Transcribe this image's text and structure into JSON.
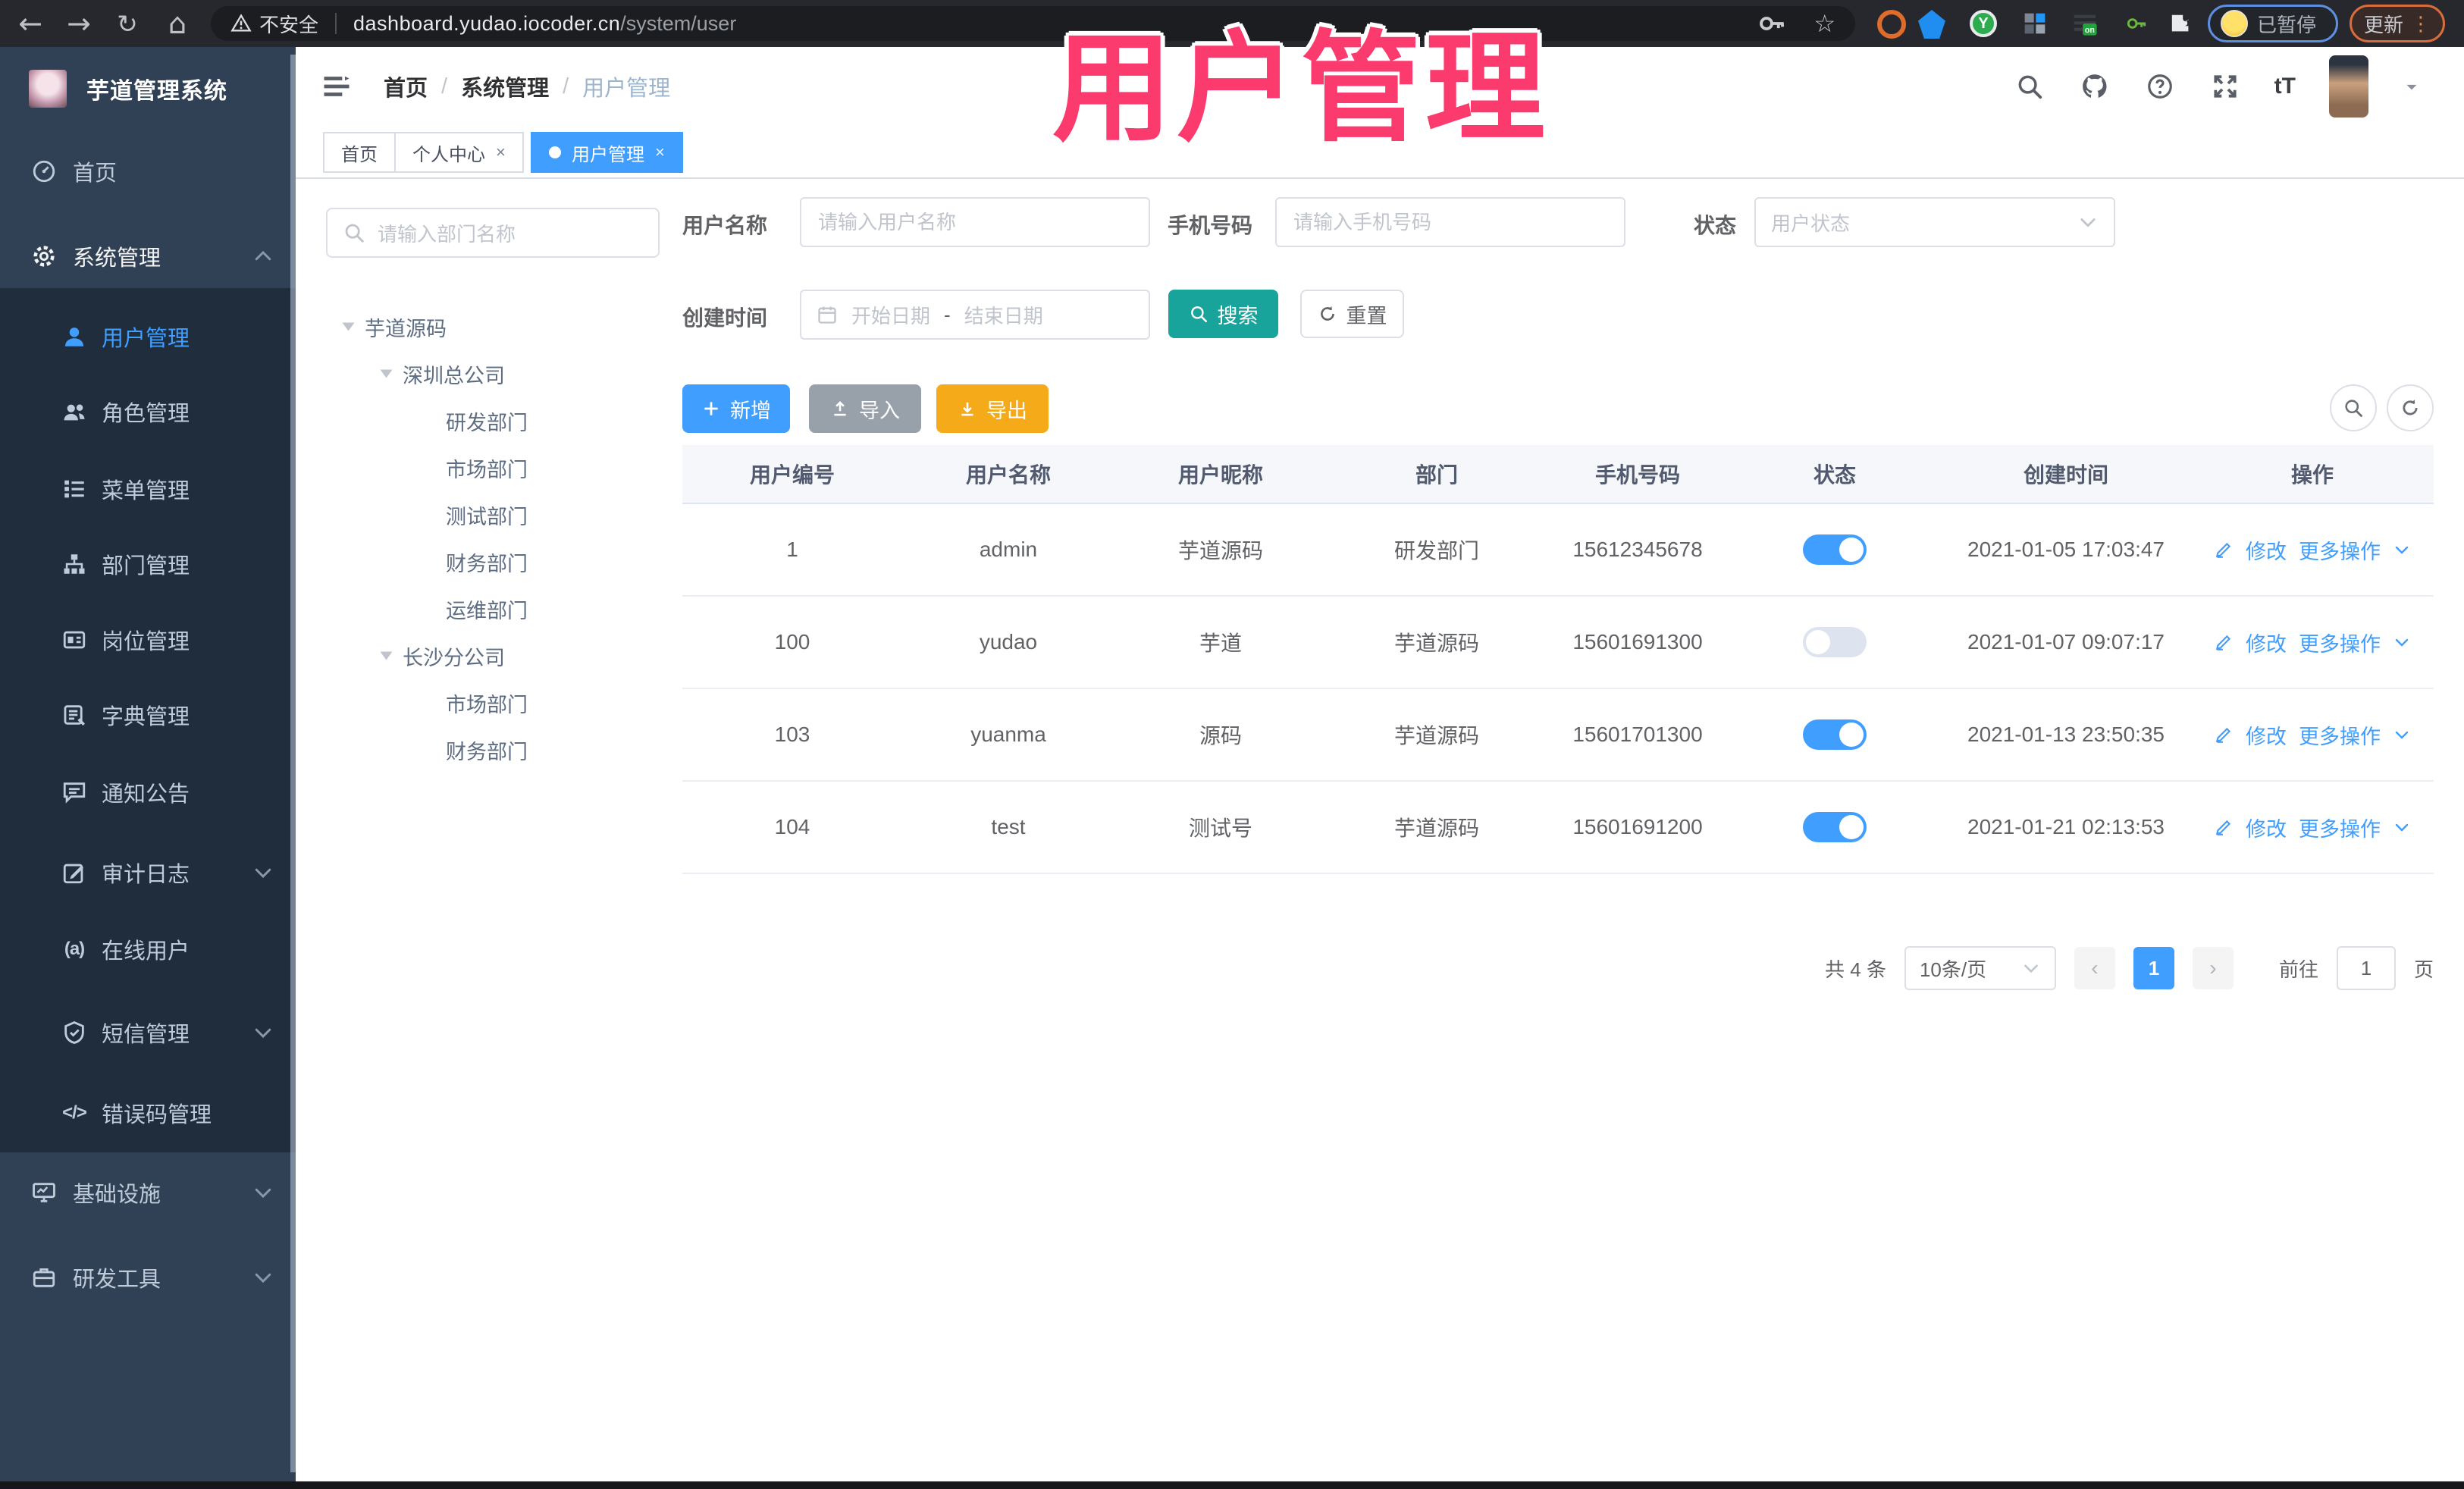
{
  "overlay": {
    "title": "用户管理"
  },
  "browser": {
    "back": "←",
    "forward": "→",
    "reload": "↻",
    "home": "⌂",
    "warning_label": "不安全",
    "url_host": "dashboard.yudao.iocoder.cn",
    "url_path": "/system/user",
    "star": "☆",
    "paused_badge": "已暂停",
    "update_button": "更新",
    "kebab": "⋮"
  },
  "brand": {
    "title": "芋道管理系统"
  },
  "sidebar": {
    "items": [
      {
        "label": "首页"
      },
      {
        "label": "系统管理"
      },
      {
        "label": "用户管理"
      },
      {
        "label": "角色管理"
      },
      {
        "label": "菜单管理"
      },
      {
        "label": "部门管理"
      },
      {
        "label": "岗位管理"
      },
      {
        "label": "字典管理"
      },
      {
        "label": "通知公告"
      },
      {
        "label": "审计日志"
      },
      {
        "label": "在线用户"
      },
      {
        "label": "短信管理"
      },
      {
        "label": "错误码管理"
      },
      {
        "label": "基础设施"
      },
      {
        "label": "研发工具"
      }
    ],
    "online_icon_text": "(a)",
    "code_icon_text": "</>"
  },
  "breadcrumb": {
    "items": [
      "首页",
      "系统管理",
      "用户管理"
    ],
    "separator": "/"
  },
  "tabs": [
    {
      "label": "首页"
    },
    {
      "label": "个人中心"
    },
    {
      "label": "用户管理"
    }
  ],
  "tab_close": "×",
  "header_icons": {
    "font_size": "tT"
  },
  "tree": {
    "search_placeholder": "请输入部门名称",
    "root": "芋道源码",
    "branches": [
      {
        "label": "深圳总公司",
        "children": [
          "研发部门",
          "市场部门",
          "测试部门",
          "财务部门",
          "运维部门"
        ]
      },
      {
        "label": "长沙分公司",
        "children": [
          "市场部门",
          "财务部门"
        ]
      }
    ]
  },
  "filters": {
    "username_label": "用户名称",
    "username_placeholder": "请输入用户名称",
    "mobile_label": "手机号码",
    "mobile_placeholder": "请输入手机号码",
    "status_label": "状态",
    "status_placeholder": "用户状态",
    "created_label": "创建时间",
    "date_start_placeholder": "开始日期",
    "date_separator": "-",
    "date_end_placeholder": "结束日期",
    "search_button": "搜索",
    "reset_button": "重置"
  },
  "toolbar": {
    "add_label": "新增",
    "import_label": "导入",
    "export_label": "导出"
  },
  "table": {
    "headers": [
      "用户编号",
      "用户名称",
      "用户昵称",
      "部门",
      "手机号码",
      "状态",
      "创建时间",
      "操作"
    ],
    "edit_label": "修改",
    "more_label": "更多操作",
    "rows": [
      {
        "id": "1",
        "username": "admin",
        "nickname": "芋道源码",
        "dept": "研发部门",
        "mobile": "15612345678",
        "status_on": true,
        "created": "2021-01-05 17:03:47"
      },
      {
        "id": "100",
        "username": "yudao",
        "nickname": "芋道",
        "dept": "芋道源码",
        "mobile": "15601691300",
        "status_on": false,
        "created": "2021-01-07 09:07:17"
      },
      {
        "id": "103",
        "username": "yuanma",
        "nickname": "源码",
        "dept": "芋道源码",
        "mobile": "15601701300",
        "status_on": true,
        "created": "2021-01-13 23:50:35"
      },
      {
        "id": "104",
        "username": "test",
        "nickname": "测试号",
        "dept": "芋道源码",
        "mobile": "15601691200",
        "status_on": true,
        "created": "2021-01-21 02:13:53"
      }
    ]
  },
  "pagination": {
    "total": "共 4 条",
    "page_size": "10条/页",
    "prev": "‹",
    "next": "›",
    "current_page": "1",
    "goto_label": "前往",
    "goto_value": "1",
    "page_unit": "页"
  },
  "colors": {
    "accent": "#409eff",
    "search_teal": "#18a39b",
    "export_amber": "#f5ab19",
    "overlay_pink": "#fb3a6e",
    "sidebar_bg": "#304156",
    "submenu_bg": "#1f2d3d"
  }
}
